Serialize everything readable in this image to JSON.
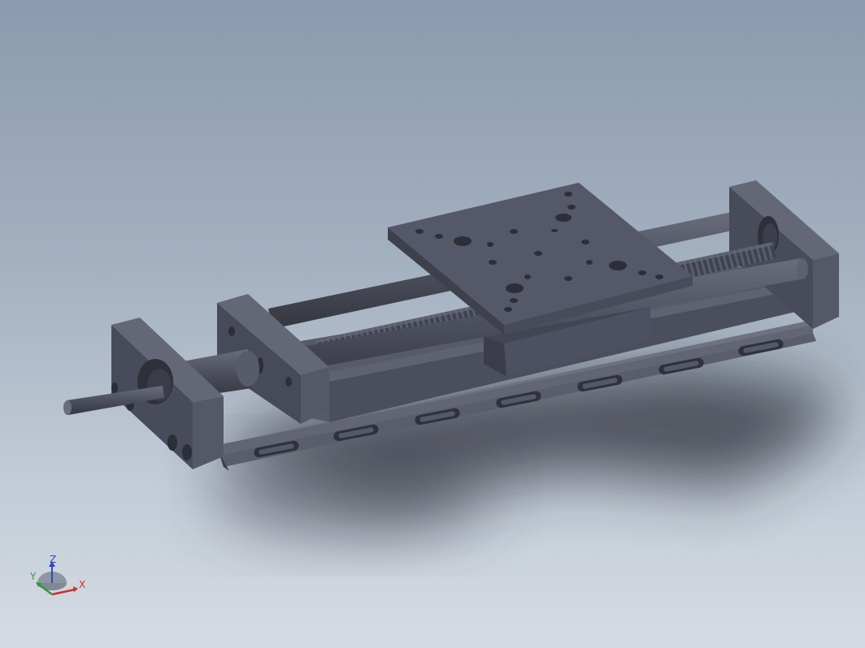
{
  "viewport": {
    "background_top": "#8b9aae",
    "background_bottom": "#d5dbe3",
    "model_color": "#4d505f"
  },
  "triad": {
    "x_label": "X",
    "y_label": "Y",
    "z_label": "Z",
    "x_color": "#c8312d",
    "y_color": "#2f9a3a",
    "z_color": "#2f49b8"
  }
}
